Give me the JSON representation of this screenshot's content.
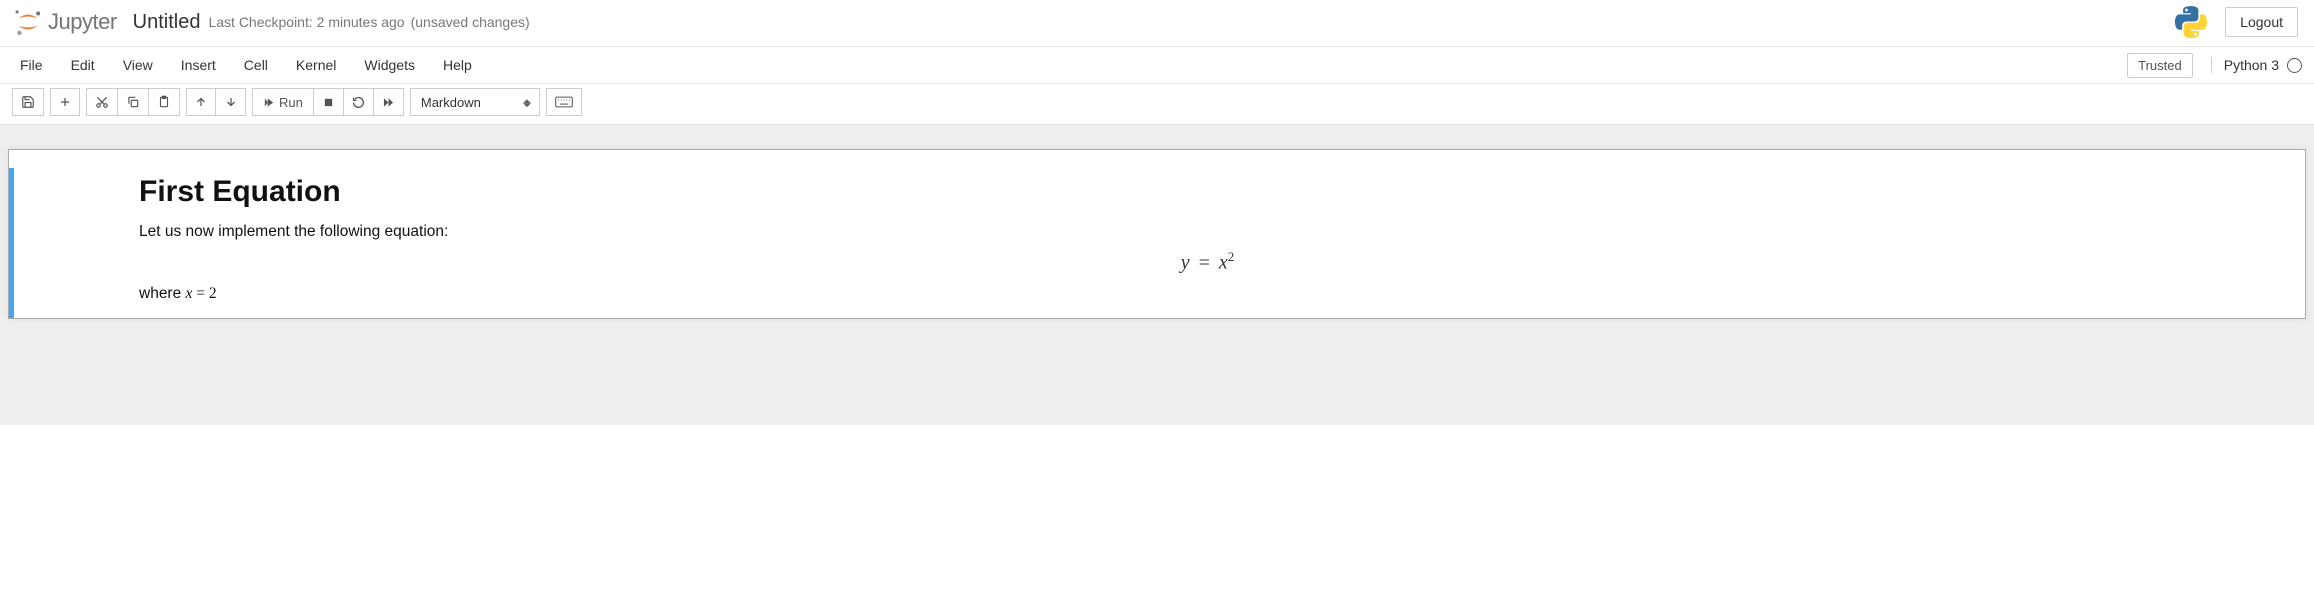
{
  "header": {
    "logo_text": "Jupyter",
    "notebook_name": "Untitled",
    "checkpoint": "Last Checkpoint: 2 minutes ago",
    "unsaved": "(unsaved changes)",
    "logout_label": "Logout"
  },
  "menubar": {
    "items": [
      "File",
      "Edit",
      "View",
      "Insert",
      "Cell",
      "Kernel",
      "Widgets",
      "Help"
    ],
    "trusted": "Trusted",
    "kernel_name": "Python 3"
  },
  "toolbar": {
    "run_label": "Run",
    "cell_type": "Markdown"
  },
  "cell": {
    "heading": "First Equation",
    "intro": "Let us now implement the following equation:",
    "equation_y": "y",
    "equation_eq": "=",
    "equation_x": "x",
    "equation_exp": "2",
    "where_prefix": "where ",
    "where_x": "x",
    "where_eq": " = ",
    "where_val": "2"
  }
}
